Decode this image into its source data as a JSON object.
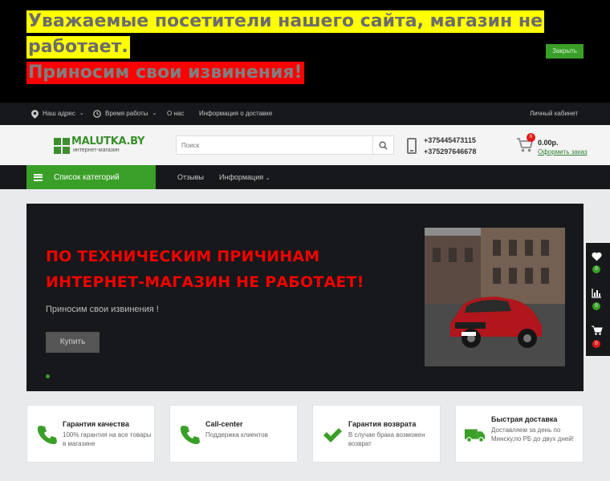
{
  "notice": {
    "line1": "Уважаемые посетители нашего сайта, магазин не",
    "line2": "работает.",
    "line3": "Приносим свои извинения!",
    "close_label": "Закрыть"
  },
  "topnav": {
    "address": "Наш адрес",
    "hours": "Время работы",
    "about": "О нас",
    "delivery": "Информация о доставке",
    "account": "Личный кабинет"
  },
  "header": {
    "logo_text": "MALUTKA.BY",
    "logo_sub": "интернет-магазин",
    "search_placeholder": "Поиск",
    "phone1": "+375445473115",
    "phone2": "+375297646678",
    "cart_count": "0",
    "cart_sum": "0.00р.",
    "cart_order": "Оформить заказ"
  },
  "catbar": {
    "categories": "Список категорий",
    "reviews": "Отзывы",
    "info": "Информация"
  },
  "hero": {
    "title_line1": "ПО ТЕХНИЧЕСКИМ ПРИЧИНАМ",
    "title_line2": "ИНТЕРНЕТ-МАГАЗИН НЕ РАБОТАЕТ!",
    "subtitle": "Приносим свои извинения !",
    "buy_label": "Купить"
  },
  "side": {
    "wishlist_count": "0",
    "compare_count": "0",
    "cart_count": "0"
  },
  "features": [
    {
      "title": "Гарантия качества",
      "text": "100% гарантия на все товары в магазине",
      "icon": "phone-icon"
    },
    {
      "title": "Call-center",
      "text": "Поддержка клиентов",
      "icon": "phone-icon"
    },
    {
      "title": "Гарантия возврата",
      "text": "В случае брака возможен возврат",
      "icon": "check-icon"
    },
    {
      "title": "Быстрая доставка",
      "text": "Доставляем за день по Минску,по РБ до двух дней!",
      "icon": "truck-icon"
    }
  ],
  "colors": {
    "accent_green": "#3a9f28",
    "dark_bg": "#16181b",
    "hero_red": "#f40000",
    "badge_red": "#e01c1c"
  }
}
